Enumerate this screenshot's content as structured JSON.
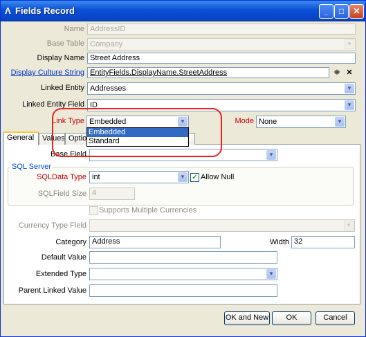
{
  "window": {
    "title": "Fields Record",
    "app_icon": "Λ"
  },
  "form": {
    "name_label": "Name",
    "name_value": "AddressID",
    "base_table_label": "Base Table",
    "base_table_value": "Company",
    "display_name_label": "Display Name",
    "display_name_value": "Street Address",
    "display_culture_label": "Display Culture String",
    "display_culture_value": "EntityFields.DisplayName.StreetAddress",
    "linked_entity_label": "Linked Entity",
    "linked_entity_value": "Addresses",
    "linked_entity_field_label": "Linked Entity Field",
    "linked_entity_field_value": "ID",
    "link_type_label": "Link Type",
    "link_type_value": "Embedded",
    "link_type_options": [
      "Embedded",
      "Standard"
    ],
    "mode_label": "Mode",
    "mode_value": "None"
  },
  "tabs": [
    "General",
    "Values",
    "Optio"
  ],
  "general": {
    "base_field_label": "Base Field",
    "base_field_value": "",
    "sql_group_label": "SQL Server",
    "sql_data_type_label": "SQLData Type",
    "sql_data_type_value": "int",
    "allow_null_label": "Allow Null",
    "allow_null_checked": true,
    "sql_field_size_label": "SQLField Size",
    "sql_field_size_value": "4",
    "supports_multi_currency_label": "Supports Multiple Currencies",
    "supports_multi_currency_checked": false,
    "currency_type_field_label": "Currency Type Field",
    "currency_type_field_value": "",
    "category_label": "Category",
    "category_value": "Address",
    "width_label": "Width",
    "width_value": "32",
    "default_value_label": "Default Value",
    "default_value_value": "",
    "extended_type_label": "Extended Type",
    "extended_type_value": "",
    "parent_linked_value_label": "Parent Linked Value",
    "parent_linked_value_value": ""
  },
  "buttons": {
    "ok_new": "OK and New",
    "ok": "OK",
    "cancel": "Cancel"
  },
  "icons": {
    "find": "binoculars-icon",
    "clear": "clear-x-icon"
  },
  "colors": {
    "required_label": "#c00000",
    "link_label": "#0033cc",
    "selection": "#316ac5",
    "annotation_ring": "#e8221d"
  }
}
